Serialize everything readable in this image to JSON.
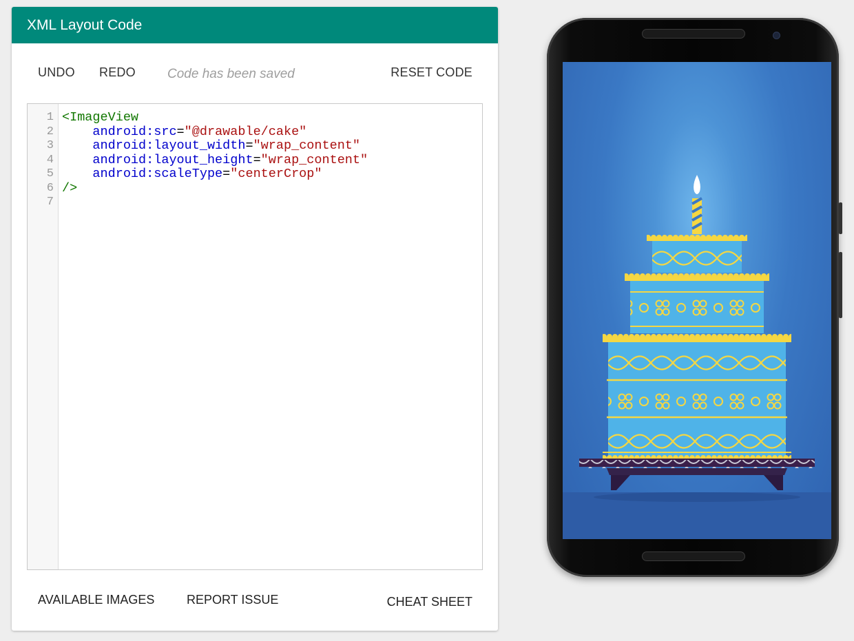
{
  "panel": {
    "title": "XML Layout Code"
  },
  "toolbar": {
    "undo": "UNDO",
    "redo": "REDO",
    "status": "Code has been saved",
    "reset": "RESET CODE"
  },
  "editor": {
    "line_numbers": [
      "1",
      "2",
      "3",
      "4",
      "5",
      "6",
      "7"
    ],
    "lines": [
      [
        {
          "t": "tag",
          "v": "<ImageView"
        }
      ],
      [
        {
          "t": "punc",
          "v": "    "
        },
        {
          "t": "attr",
          "v": "android:src"
        },
        {
          "t": "punc",
          "v": "="
        },
        {
          "t": "str",
          "v": "\"@drawable/cake\""
        }
      ],
      [
        {
          "t": "punc",
          "v": "    "
        },
        {
          "t": "attr",
          "v": "android:layout_width"
        },
        {
          "t": "punc",
          "v": "="
        },
        {
          "t": "str",
          "v": "\"wrap_content\""
        }
      ],
      [
        {
          "t": "punc",
          "v": "    "
        },
        {
          "t": "attr",
          "v": "android:layout_height"
        },
        {
          "t": "punc",
          "v": "="
        },
        {
          "t": "str",
          "v": "\"wrap_content\""
        }
      ],
      [
        {
          "t": "punc",
          "v": "    "
        },
        {
          "t": "attr",
          "v": "android:scaleType"
        },
        {
          "t": "punc",
          "v": "="
        },
        {
          "t": "str",
          "v": "\"centerCrop\""
        }
      ],
      [
        {
          "t": "tag",
          "v": "/>"
        }
      ],
      []
    ]
  },
  "footer": {
    "available_images": "AVAILABLE IMAGES",
    "report_issue": "REPORT ISSUE",
    "cheat_sheet": "CHEAT SHEET"
  },
  "preview": {
    "image": "birthday-cake-illustration",
    "colors": {
      "accent": "#00897b",
      "cake_blue": "#4fb3e8",
      "frosting_yellow": "#f5d742",
      "background_blue": "#3a78c4"
    }
  }
}
